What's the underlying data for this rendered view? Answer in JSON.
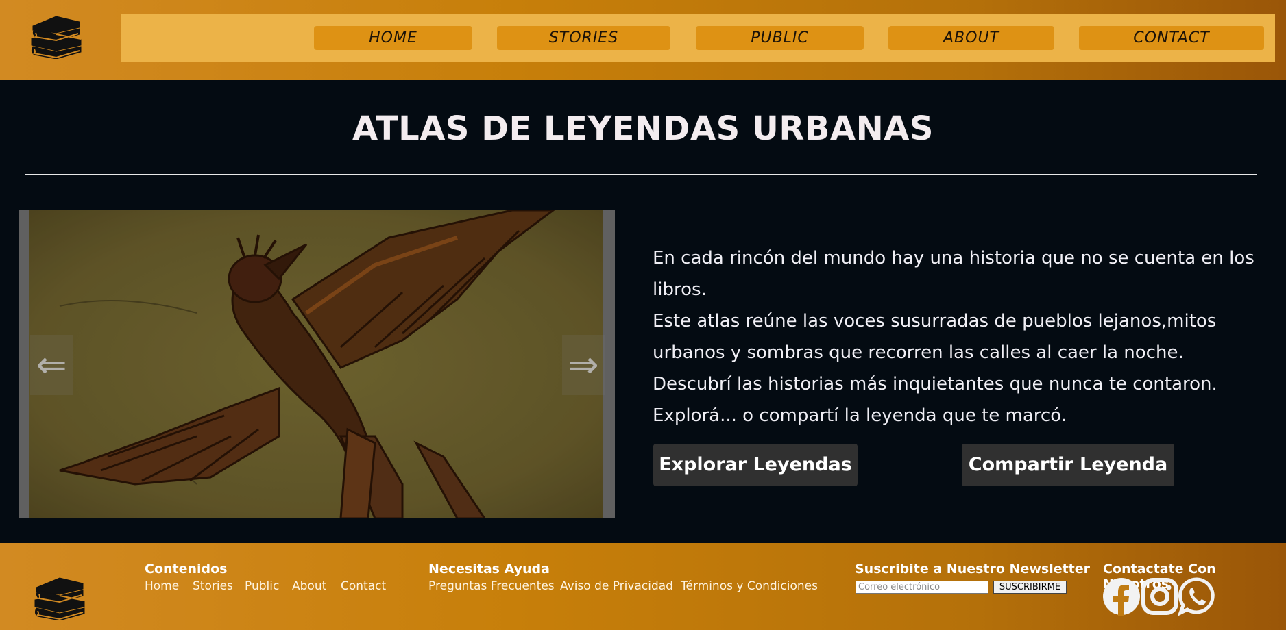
{
  "nav": {
    "items": [
      {
        "label": "HOME"
      },
      {
        "label": "STORIES"
      },
      {
        "label": "PUBLIC"
      },
      {
        "label": "ABOUT"
      },
      {
        "label": "CONTACT"
      }
    ]
  },
  "hero": {
    "title": "ATLAS DE LEYENDAS URBANAS",
    "intro_lines": [
      "En cada rincón del mundo hay una historia que no se cuenta en los libros.",
      "Este atlas reúne las voces susurradas de pueblos lejanos,mitos urbanos y sombras que recorren las calles al caer la noche.",
      "Descubrí las historias más inquietantes que nunca te contaron.",
      "Explorá... o compartí la leyenda que te marcó."
    ],
    "carousel": {
      "prev_icon": "⇐",
      "next_icon": "⇒",
      "image_icon": "bird-illustration"
    },
    "buttons": {
      "explore": "Explorar Leyendas",
      "share": "Compartir Leyenda"
    }
  },
  "footer": {
    "contents": {
      "heading": "Contenidos",
      "links": [
        "Home",
        "Stories",
        "Public",
        "About",
        "Contact"
      ]
    },
    "help": {
      "heading": "Necesitas Ayuda",
      "links": [
        "Preguntas Frecuentes",
        "Aviso de Privacidad",
        "Términos y Condiciones"
      ]
    },
    "newsletter": {
      "heading": "Suscribite a Nuestro Newsletter",
      "placeholder": "Correo electrónico",
      "button": "SUSCRIBIRME"
    },
    "contact": {
      "heading": "Contactate Con Nosotros",
      "social_icons": [
        "facebook-icon",
        "instagram-icon",
        "whatsapp-icon"
      ]
    }
  },
  "colors": {
    "header_gold": "#c77f0a",
    "navbar_bg": "#ecb348",
    "nav_button": "#de9214",
    "page_bg": "#040b12",
    "cta_bg": "#303030"
  }
}
